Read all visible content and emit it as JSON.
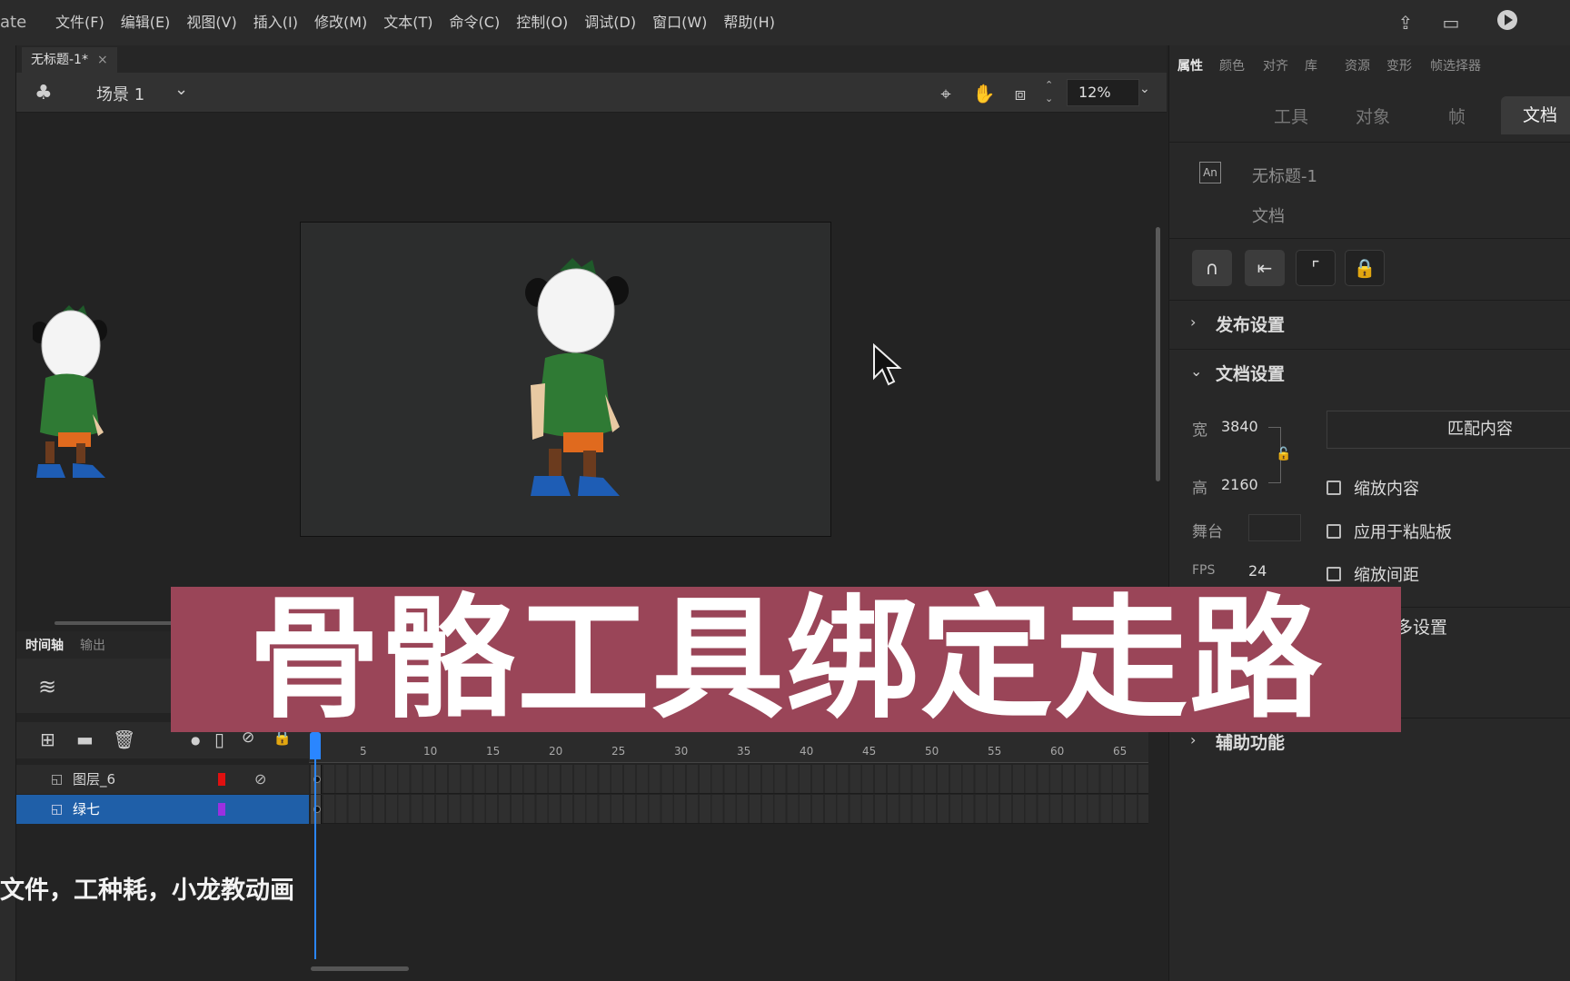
{
  "app": {
    "title_fragment": "ate"
  },
  "menu": [
    "文件(F)",
    "编辑(E)",
    "视图(V)",
    "插入(I)",
    "修改(M)",
    "文本(T)",
    "命令(C)",
    "控制(O)",
    "调试(D)",
    "窗口(W)",
    "帮助(H)"
  ],
  "document_tab": {
    "title": "无标题-1*",
    "close": "×"
  },
  "scene": {
    "label": "场景 1",
    "zoom": "12%"
  },
  "timeline": {
    "tabs": [
      "时间轴",
      "输出"
    ],
    "ruler": [
      "5",
      "10",
      "15",
      "20",
      "25",
      "30",
      "35",
      "40",
      "45",
      "50",
      "55",
      "60",
      "65"
    ],
    "layers": [
      {
        "name": "图层_6",
        "color": "#e01010",
        "hidden": true,
        "selected": false
      },
      {
        "name": "绿七",
        "color": "#9b30e0",
        "hidden": false,
        "selected": true
      }
    ]
  },
  "subtitle": "文件，工种耗，小龙教动画",
  "banner": {
    "text": "骨骼工具绑定走路",
    "color": "#9a4558"
  },
  "properties": {
    "tabs": [
      "属性",
      "颜色",
      "对齐",
      "库",
      "资源",
      "变形",
      "帧选择器"
    ],
    "sub_tabs": [
      "工具",
      "对象",
      "帧",
      "文档"
    ],
    "doc_icon": "An",
    "doc_name": "无标题-1",
    "doc_type": "文档",
    "sections": {
      "publish": "发布设置",
      "document": "文档设置",
      "more": "多设置",
      "accessibility": "辅助功能"
    },
    "width_label": "宽",
    "width_value": "3840",
    "height_label": "高",
    "height_value": "2160",
    "stage_label": "舞台",
    "fps_label": "FPS",
    "fps_value": "24",
    "match_button": "匹配内容",
    "checkboxes": [
      "缩放内容",
      "应用于粘贴板",
      "缩放间距"
    ]
  }
}
